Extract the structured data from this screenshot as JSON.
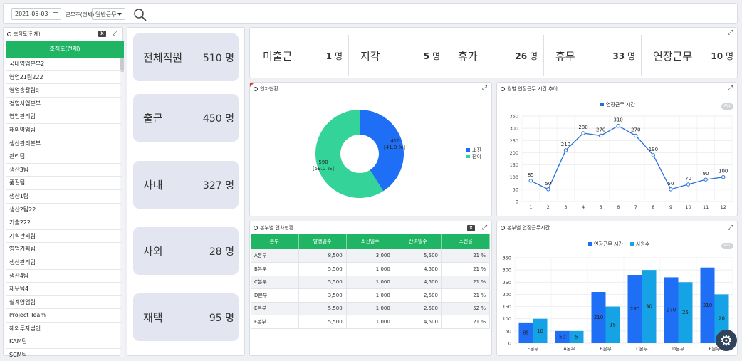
{
  "toolbar": {
    "date": "2021-05-03",
    "work_type_label": "근무조(전체)",
    "work_type_value": "일반근무"
  },
  "org": {
    "title": "조직도(전체)",
    "header": "조직도(전체)",
    "items": [
      "국내영업본부2",
      "영업21팀222",
      "영업총괄팀q",
      "경영사업본부",
      "영업관리팀",
      "해외영업팀",
      "생산관리본부",
      "관리팀",
      "생산3팀",
      "품질팀",
      "생산1팀",
      "생산2팀22",
      "기술222",
      "기획관리팀",
      "영업기획팀",
      "생산관리팀",
      "생산4팀",
      "재무팀4",
      "설계영업팀",
      "Project Team",
      "해외투자법인",
      "KAM팀",
      "SCM팀"
    ]
  },
  "cards": [
    {
      "label": "전체직원",
      "value": "510",
      "unit": "명"
    },
    {
      "label": "출근",
      "value": "450",
      "unit": "명"
    },
    {
      "label": "사내",
      "value": "327",
      "unit": "명"
    },
    {
      "label": "사외",
      "value": "28",
      "unit": "명"
    },
    {
      "label": "재택",
      "value": "95",
      "unit": "명"
    }
  ],
  "stats": [
    {
      "label": "미출근",
      "value": "1",
      "unit": "명"
    },
    {
      "label": "지각",
      "value": "5",
      "unit": "명"
    },
    {
      "label": "휴가",
      "value": "26",
      "unit": "명"
    },
    {
      "label": "휴무",
      "value": "33",
      "unit": "명"
    },
    {
      "label": "연장근무",
      "value": "10",
      "unit": "명"
    }
  ],
  "leave": {
    "title": "연차현황",
    "used_label": "410",
    "used_pct": "[41.0 %]",
    "remain_label": "590",
    "remain_pct": "[59.0 %]",
    "legend": [
      "소진",
      "잔여"
    ]
  },
  "overtime_trend": {
    "title": "월별 연장근무 시간 추이",
    "all_label": "ALL"
  },
  "dept_leave": {
    "title": "본부별 연차현황",
    "columns": [
      "본부",
      "발생일수",
      "소진일수",
      "잔여일수",
      "소진율"
    ],
    "rows": [
      [
        "A본부",
        "8,500",
        "3,000",
        "5,500",
        "21 %"
      ],
      [
        "B본부",
        "5,500",
        "1,000",
        "4,500",
        "21 %"
      ],
      [
        "C본부",
        "5,500",
        "1,000",
        "4,500",
        "21 %"
      ],
      [
        "D본부",
        "3,500",
        "1,000",
        "2,500",
        "21 %"
      ],
      [
        "E본부",
        "5,500",
        "1,000",
        "2,500",
        "52 %"
      ],
      [
        "F본부",
        "5,500",
        "1,000",
        "4,500",
        "21 %"
      ]
    ]
  },
  "dept_overtime": {
    "title": "본부별 연장근무시간",
    "all_label": "ALL"
  },
  "colors": {
    "green": "#1fb565",
    "blue": "#1e6ff5",
    "teal": "#34d399",
    "line": "#2a6fd6",
    "lightblue": "#16a3e6"
  },
  "chart_data": [
    {
      "type": "pie",
      "title": "연차현황",
      "categories": [
        "소진",
        "잔여"
      ],
      "values": [
        410,
        590
      ],
      "percent": [
        41.0,
        59.0
      ],
      "colors": [
        "#1e6ff5",
        "#34d399"
      ]
    },
    {
      "type": "line",
      "title": "월별 연장근무 시간 추이",
      "x": [
        1,
        2,
        3,
        4,
        5,
        6,
        7,
        8,
        9,
        10,
        11,
        12
      ],
      "series": [
        {
          "name": "연장근무 시간",
          "values": [
            85,
            50,
            210,
            280,
            270,
            310,
            270,
            190,
            50,
            70,
            90,
            100
          ]
        }
      ],
      "labels": [
        "85",
        "50",
        "210",
        "280",
        "270",
        "310",
        "270",
        "190",
        "50",
        "70",
        "90",
        "100"
      ],
      "ylim": [
        0,
        350
      ],
      "yticks": [
        0,
        50,
        100,
        150,
        200,
        250,
        300,
        350
      ],
      "legend": "top"
    },
    {
      "type": "bar",
      "title": "본부별 연장근무시간",
      "categories": [
        "F본부",
        "A본부",
        "B본부",
        "C본부",
        "D본부",
        "E본부"
      ],
      "series": [
        {
          "name": "연장근무 시간",
          "values": [
            85,
            50,
            210,
            280,
            270,
            310
          ]
        },
        {
          "name": "사원수",
          "values": [
            100,
            50,
            150,
            300,
            250,
            200
          ]
        }
      ],
      "bar_labels": [
        [
          "85",
          "50",
          "210",
          "280",
          "270",
          "310"
        ],
        [
          "10",
          "5",
          "15",
          "30",
          "25",
          "20"
        ]
      ],
      "ylim": [
        0,
        350
      ],
      "yticks": [
        0,
        50,
        100,
        150,
        200,
        250,
        300,
        350
      ],
      "legend": "top"
    }
  ]
}
